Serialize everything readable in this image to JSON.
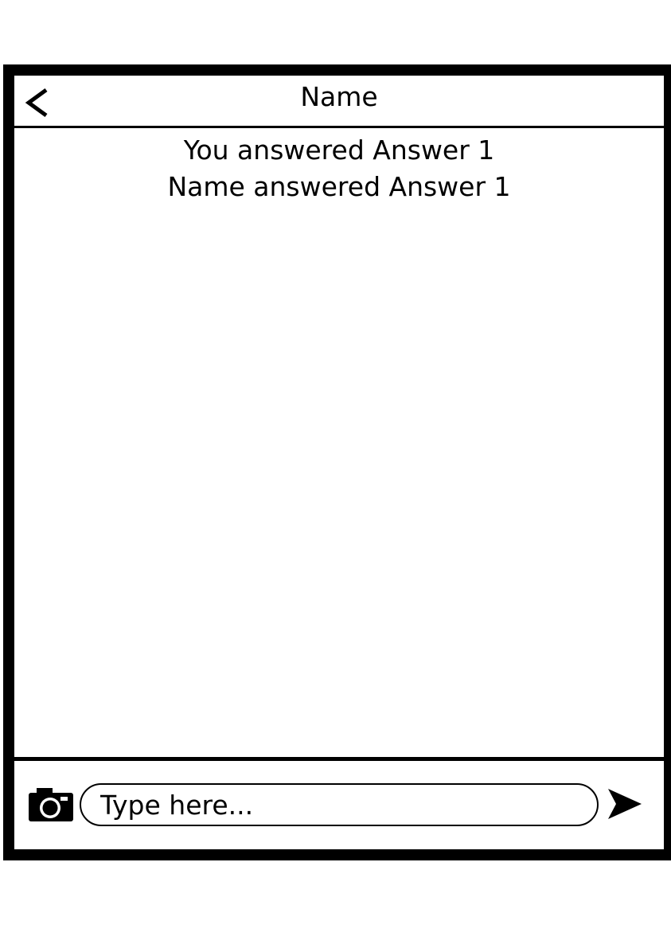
{
  "header": {
    "title": "Name",
    "back_icon": "chevron-left-icon"
  },
  "messages": [
    {
      "text": "You answered Answer 1"
    },
    {
      "text": "Name answered Answer 1"
    }
  ],
  "composer": {
    "camera_icon": "camera-icon",
    "input_placeholder": "Type here...",
    "input_value": "",
    "send_icon": "send-icon"
  },
  "colors": {
    "frame": "#000000",
    "background": "#ffffff",
    "text": "#000000"
  }
}
